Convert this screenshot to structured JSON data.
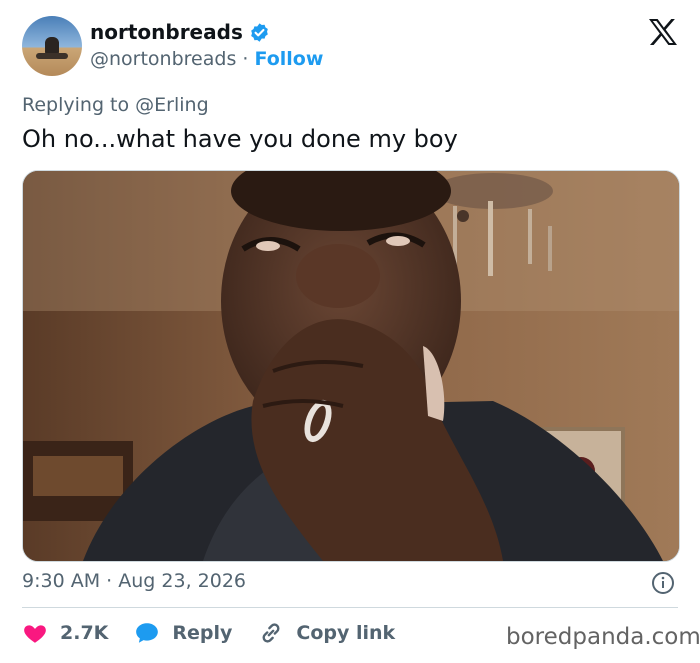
{
  "author": {
    "name": "nortonbreads",
    "handle": "@nortonbreads",
    "separator": "·",
    "follow_label": "Follow",
    "verified": true
  },
  "replying": {
    "prefix": "Replying to",
    "to": "@Erling"
  },
  "tweet": {
    "text": "Oh no...what have you done my boy"
  },
  "meta": {
    "time": "9:30 AM",
    "separator": "·",
    "date": "Aug 23, 2026"
  },
  "actions": {
    "like_count": "2.7K",
    "reply_label": "Reply",
    "copy_label": "Copy link"
  },
  "watermark": "boredpanda.com",
  "colors": {
    "accent": "#1d9bf0",
    "like": "#f91880",
    "secondary_text": "#536471",
    "primary_text": "#0f1419"
  },
  "icons": [
    "verified-badge-icon",
    "x-logo-icon",
    "info-icon",
    "heart-icon",
    "reply-bubble-icon",
    "link-icon"
  ]
}
